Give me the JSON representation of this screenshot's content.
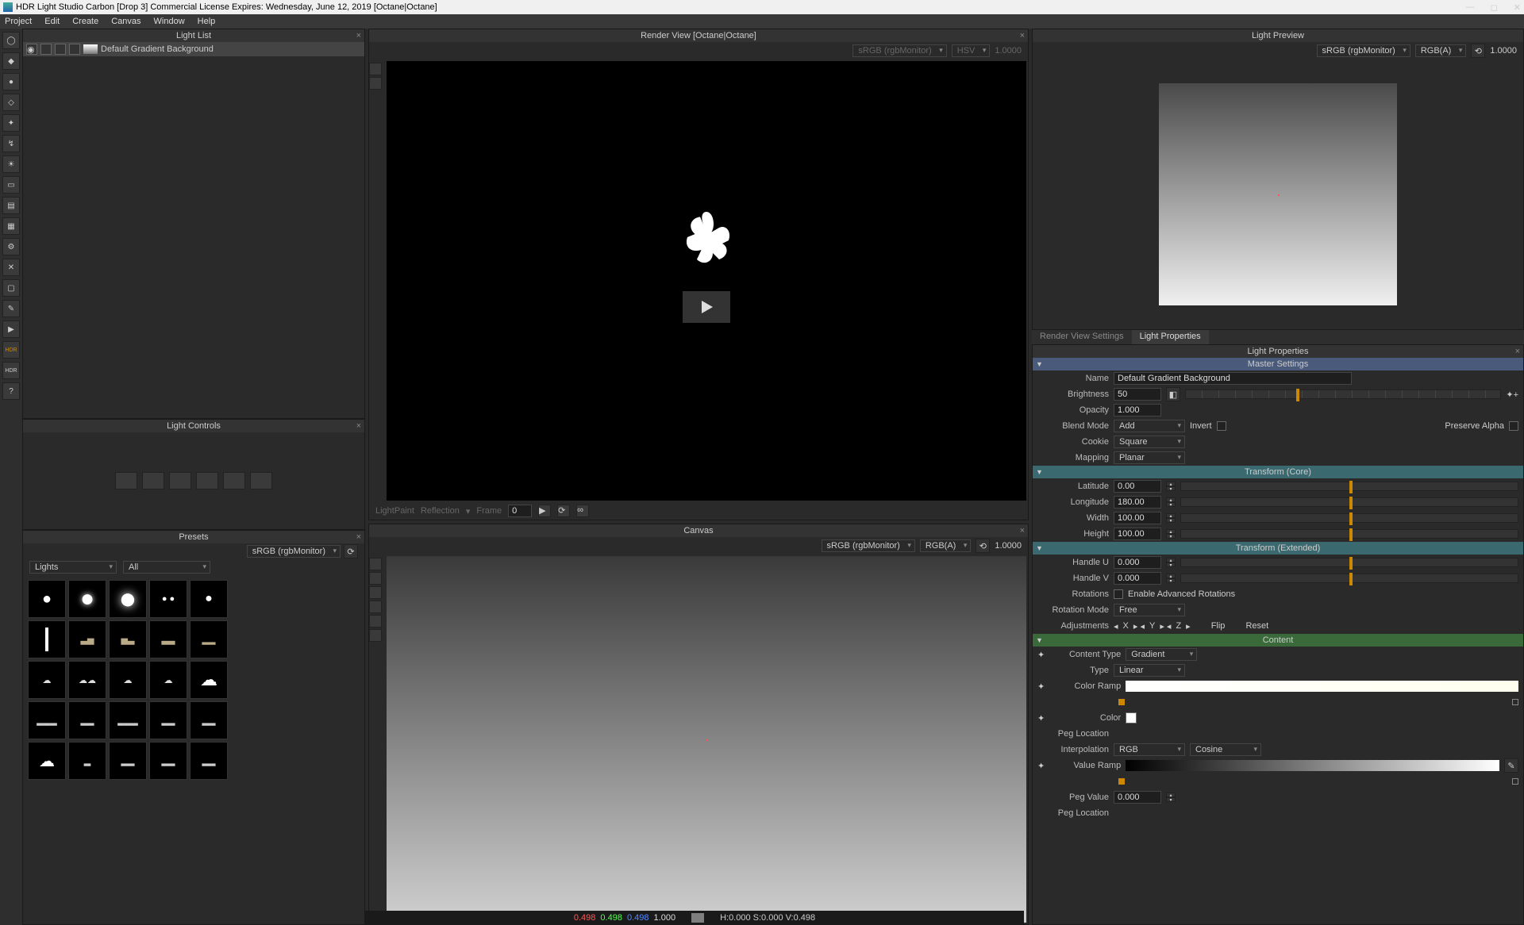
{
  "titlebar": {
    "title": "HDR Light Studio Carbon [Drop 3] Commercial License Expires: Wednesday, June 12, 2019  [Octane|Octane]"
  },
  "menubar": [
    "Project",
    "Edit",
    "Create",
    "Canvas",
    "Window",
    "Help"
  ],
  "panels": {
    "light_list_title": "Light List",
    "light_controls_title": "Light Controls",
    "presets_title": "Presets",
    "render_view_title": "Render View [Octane|Octane]",
    "canvas_title": "Canvas",
    "light_preview_title": "Light Preview",
    "light_properties_title": "Light Properties"
  },
  "light_list": {
    "item_name": "Default Gradient Background"
  },
  "presets": {
    "colorspace": "sRGB (rgbMonitor)",
    "category": "Lights",
    "filter": "All"
  },
  "render_view": {
    "colorspace": "sRGB (rgbMonitor)",
    "channels": "HSV",
    "exposure": "1.0000",
    "footer_mode1": "LightPaint",
    "footer_mode2": "Reflection",
    "frame_label": "Frame",
    "frame_value": "0"
  },
  "canvas": {
    "colorspace": "sRGB (rgbMonitor)",
    "channels": "RGB(A)",
    "exposure": "1.0000"
  },
  "light_preview": {
    "colorspace": "sRGB (rgbMonitor)",
    "channels": "RGB(A)",
    "exposure": "1.0000"
  },
  "tabs": {
    "render_settings": "Render View Settings",
    "light_properties": "Light Properties"
  },
  "props": {
    "sections": {
      "master": "Master Settings",
      "transform_core": "Transform (Core)",
      "transform_ext": "Transform (Extended)",
      "content": "Content"
    },
    "name_label": "Name",
    "name_value": "Default Gradient Background",
    "brightness_label": "Brightness",
    "brightness_value": "50",
    "opacity_label": "Opacity",
    "opacity_value": "1.000",
    "blend_label": "Blend Mode",
    "blend_value": "Add",
    "invert_label": "Invert",
    "preserve_alpha_label": "Preserve Alpha",
    "cookie_label": "Cookie",
    "cookie_value": "Square",
    "mapping_label": "Mapping",
    "mapping_value": "Planar",
    "latitude_label": "Latitude",
    "latitude_value": "0.00",
    "longitude_label": "Longitude",
    "longitude_value": "180.00",
    "width_label": "Width",
    "width_value": "100.00",
    "height_label": "Height",
    "height_value": "100.00",
    "handleu_label": "Handle U",
    "handleu_value": "0.000",
    "handlev_label": "Handle V",
    "handlev_value": "0.000",
    "rotations_label": "Rotations",
    "rotations_opt": "Enable Advanced Rotations",
    "rotmode_label": "Rotation Mode",
    "rotmode_value": "Free",
    "adjust_label": "Adjustments",
    "adj_x": "X",
    "adj_y": "Y",
    "adj_z": "Z",
    "adj_flip": "Flip",
    "adj_reset": "Reset",
    "content_type_label": "Content Type",
    "content_type_value": "Gradient",
    "type_label": "Type",
    "type_value": "Linear",
    "color_ramp_label": "Color Ramp",
    "color_label": "Color",
    "peg_loc_label": "Peg Location",
    "interp_label": "Interpolation",
    "interp_value": "RGB",
    "interp_curve": "Cosine",
    "value_ramp_label": "Value Ramp",
    "peg_value_label": "Peg Value",
    "peg_value_value": "0.000",
    "peg_loc2_label": "Peg Location"
  },
  "status": {
    "r": "0.498",
    "g": "0.498",
    "b": "0.498",
    "a": "1.000",
    "hsv": "H:0.000 S:0.000 V:0.498"
  }
}
